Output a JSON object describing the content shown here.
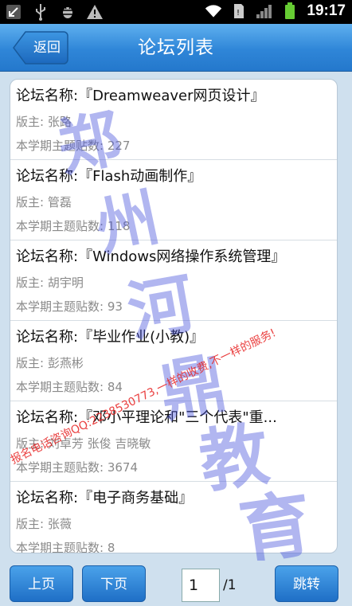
{
  "status": {
    "time": "19:17"
  },
  "header": {
    "back_label": "返回",
    "title": "论坛列表"
  },
  "forums": [
    {
      "name": "论坛名称:『Dreamweaver网页设计』",
      "owner": "版主: 张路",
      "count": "本学期主题贴数: 227"
    },
    {
      "name": "论坛名称:『Flash动画制作』",
      "owner": "版主: 管磊",
      "count": "本学期主题贴数: 118"
    },
    {
      "name": "论坛名称:『Windows网络操作系统管理』",
      "owner": "版主: 胡宇明",
      "count": "本学期主题贴数: 93"
    },
    {
      "name": "论坛名称:『毕业作业(小教)』",
      "owner": "版主: 彭燕彬",
      "count": "本学期主题贴数: 84"
    },
    {
      "name": "论坛名称:『邓小平理论和\"三个代表\"重...",
      "owner": "版主: 刘卓芳 张俊 吉晓敏",
      "count": "本学期主题贴数: 3674"
    },
    {
      "name": "论坛名称:『电子商务基础』",
      "owner": "版主: 张薇",
      "count": "本学期主题贴数: 8"
    }
  ],
  "watermark": {
    "chars": [
      "郑",
      "州",
      "河",
      "鼎",
      "教",
      "育"
    ],
    "slogan": "报名电话咨询QQ:2238530773,一样的收费,不一样的服务!"
  },
  "pager": {
    "prev_label": "上页",
    "next_label": "下页",
    "current_page": "1",
    "total": "/1",
    "go_label": "跳转"
  },
  "colors": {
    "title_bar": "#2f86d8",
    "content_bg": "#cfe0ee",
    "watermark_blue": "#4650dc",
    "watermark_red": "#e61e1e"
  }
}
